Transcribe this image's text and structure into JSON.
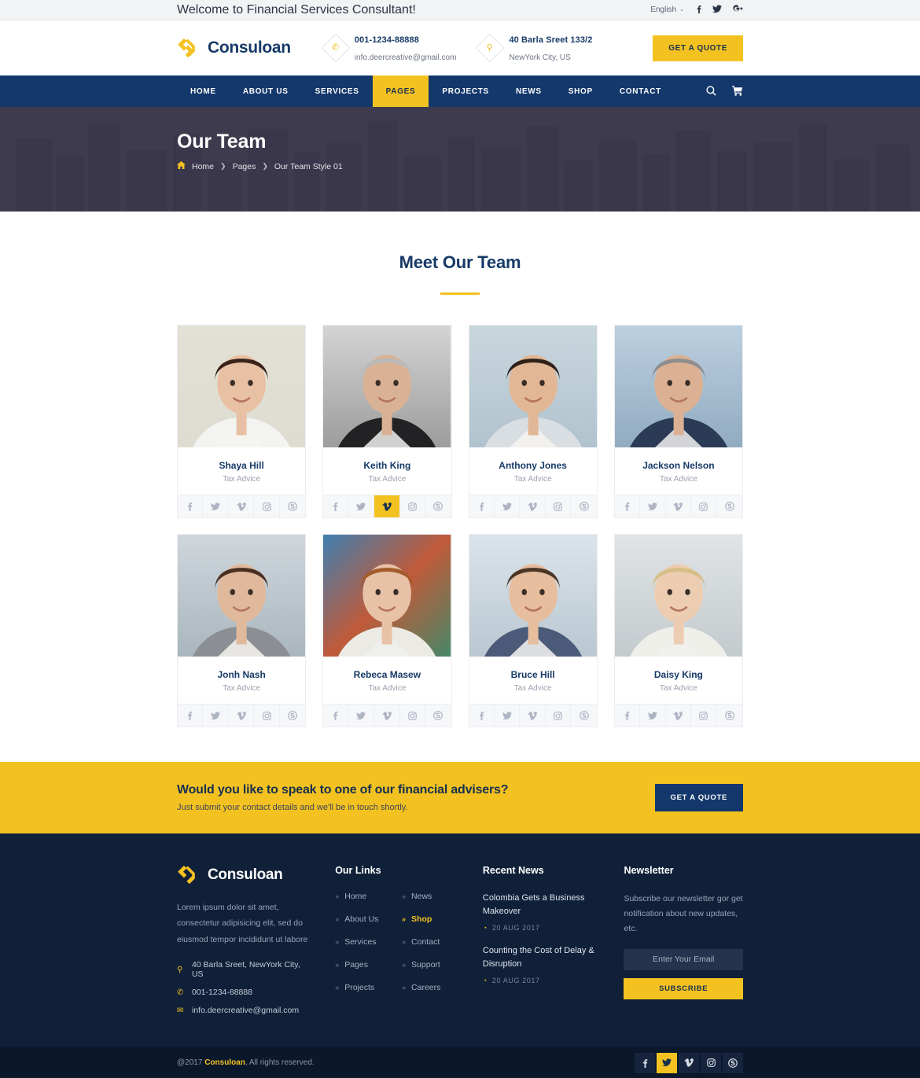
{
  "topbar": {
    "welcome": "Welcome to Financial Services Consultant!",
    "language": "English",
    "caret": "⌄",
    "social": [
      {
        "name": "facebook-icon",
        "glyph": "f"
      },
      {
        "name": "twitter-icon",
        "glyph": "🐦"
      },
      {
        "name": "google-plus-icon",
        "glyph": "g+"
      }
    ]
  },
  "header": {
    "brand": "Consuloan",
    "phone_title": "001-1234-88888",
    "phone_sub": "info.deercreative@gmail.com",
    "address_title": "40 Barla Sreet 133/2",
    "address_sub": "NewYork City, US",
    "quote_label": "GET A QUOTE",
    "phone_glyph": "✆",
    "pin_glyph": "⚲"
  },
  "nav": {
    "items": [
      {
        "label": "HOME",
        "active": false
      },
      {
        "label": "ABOUT US",
        "active": false
      },
      {
        "label": "SERVICES",
        "active": false
      },
      {
        "label": "PAGES",
        "active": true
      },
      {
        "label": "PROJECTS",
        "active": false
      },
      {
        "label": "NEWS",
        "active": false
      },
      {
        "label": "SHOP",
        "active": false
      },
      {
        "label": "CONTACT",
        "active": false
      }
    ],
    "search_glyph": "⌕",
    "cart_glyph": "🛒"
  },
  "hero": {
    "title": "Our Team",
    "home_glyph": "⌂",
    "crumbs": [
      "Home",
      "Pages",
      "Our Team Style 01"
    ],
    "sep": "❯"
  },
  "team": {
    "section_title": "Meet Our Team",
    "social_glyphs": [
      "f",
      "🐦",
      "v",
      "⊡",
      "S"
    ],
    "social_names": [
      "facebook-icon",
      "twitter-icon",
      "vimeo-icon",
      "instagram-icon",
      "skype-icon"
    ],
    "members": [
      {
        "name": "Shaya Hill",
        "role": "Tax Advice",
        "highlight": -1
      },
      {
        "name": "Keith King",
        "role": "Tax Advice",
        "highlight": 2
      },
      {
        "name": "Anthony Jones",
        "role": "Tax Advice",
        "highlight": -1
      },
      {
        "name": "Jackson Nelson",
        "role": "Tax Advice",
        "highlight": -1
      },
      {
        "name": "Jonh Nash",
        "role": "Tax Advice",
        "highlight": -1
      },
      {
        "name": "Rebeca Masew",
        "role": "Tax Advice",
        "highlight": -1
      },
      {
        "name": "Bruce Hill",
        "role": "Tax Advice",
        "highlight": -1
      },
      {
        "name": "Daisy King",
        "role": "Tax Advice",
        "highlight": -1
      }
    ]
  },
  "cta": {
    "heading": "Would you like to speak to one of our financial advisers?",
    "text": "Just submit your contact details and we'll be in touch shortly.",
    "button": "GET A QUOTE"
  },
  "footer": {
    "brand": "Consuloan",
    "about": "Lorem ipsum dolor sit amet, consectetur adipisicing elit, sed do eiusmod tempor incididunt ut labore",
    "contacts": [
      {
        "icon": "location-pin-icon",
        "glyph": "⚲",
        "text": "40 Barla Sreet, NewYork City, US"
      },
      {
        "icon": "phone-icon",
        "glyph": "✆",
        "text": "001-1234-88888"
      },
      {
        "icon": "envelope-icon",
        "glyph": "✉",
        "text": "info.deercreative@gmail.com"
      }
    ],
    "links_title": "Our Links",
    "arrow": "»",
    "links": [
      {
        "label": "Home",
        "active": false
      },
      {
        "label": "News",
        "active": false
      },
      {
        "label": "About Us",
        "active": false
      },
      {
        "label": "Shop",
        "active": true
      },
      {
        "label": "Services",
        "active": false
      },
      {
        "label": "Contact",
        "active": false
      },
      {
        "label": "Pages",
        "active": false
      },
      {
        "label": "Support",
        "active": false
      },
      {
        "label": "Projects",
        "active": false
      },
      {
        "label": "Careers",
        "active": false
      }
    ],
    "news_title": "Recent News",
    "clock_glyph": "◔",
    "news": [
      {
        "title": "Colombia Gets a Business Makeover",
        "date": "20 AUG 2017"
      },
      {
        "title": "Counting the Cost of Delay & Disruption",
        "date": "20 AUG 2017"
      }
    ],
    "newsletter_title": "Newsletter",
    "newsletter_text": "Subscribe our newsletter gor get notification about new updates, etc.",
    "email_placeholder": "Enter Your Email",
    "subscribe_label": "SUBSCRIBE"
  },
  "footbar": {
    "copy_prefix": "@2017 ",
    "copy_brand": "Consuloan",
    "copy_suffix": ", All rights reserved.",
    "social": [
      {
        "name": "facebook-icon",
        "glyph": "f",
        "active": false
      },
      {
        "name": "twitter-icon",
        "glyph": "🐦",
        "active": true
      },
      {
        "name": "vimeo-icon",
        "glyph": "v",
        "active": false
      },
      {
        "name": "instagram-icon",
        "glyph": "⊡",
        "active": false
      },
      {
        "name": "skype-icon",
        "glyph": "S",
        "active": false
      }
    ]
  },
  "colors": {
    "accent": "#f3c221",
    "navy": "#14386c",
    "dark": "#102039",
    "footbar": "#0b172b"
  }
}
